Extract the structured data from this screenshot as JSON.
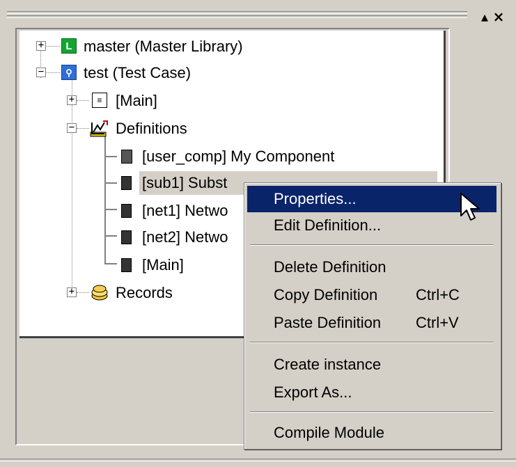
{
  "titlebar": {
    "pin_glyph": "▴",
    "close_glyph": "×"
  },
  "tree": {
    "items": [
      {
        "label": "master (Master Library)",
        "icon": "library-icon",
        "expander": "+"
      },
      {
        "label": "test (Test Case)",
        "icon": "test-case-icon",
        "expander": "−"
      },
      {
        "label": "[Main]",
        "icon": "main-page-icon",
        "expander": "+"
      },
      {
        "label": "Definitions",
        "icon": "definitions-icon",
        "expander": "−"
      },
      {
        "label": "[user_comp] My Component",
        "icon": "component-icon"
      },
      {
        "label": "[sub1] Subst",
        "icon": "page-icon"
      },
      {
        "label": "[net1] Netwo",
        "icon": "page-icon"
      },
      {
        "label": "[net2] Netwo",
        "icon": "page-icon"
      },
      {
        "label": "[Main]",
        "icon": "page-icon"
      },
      {
        "label": "Records",
        "icon": "records-icon",
        "expander": "+"
      }
    ]
  },
  "context_menu": {
    "items": [
      {
        "label": "Properties...",
        "shortcut": "",
        "highlighted": true
      },
      {
        "label": "Edit Definition...",
        "shortcut": ""
      },
      {
        "label": "Delete Definition",
        "shortcut": ""
      },
      {
        "label": "Copy Definition",
        "shortcut": "Ctrl+C"
      },
      {
        "label": "Paste Definition",
        "shortcut": "Ctrl+V"
      },
      {
        "label": "Create instance",
        "shortcut": ""
      },
      {
        "label": "Export As...",
        "shortcut": ""
      },
      {
        "label": "Compile Module",
        "shortcut": ""
      }
    ]
  },
  "colors": {
    "menu_highlight": "#0a246a",
    "panel_bg": "#d4d0c8"
  }
}
